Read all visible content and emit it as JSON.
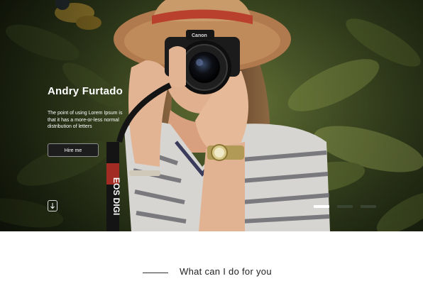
{
  "hero": {
    "name": "Andry Furtado",
    "description": "The point of using Lorem  Ipsum is that it has a more-or-less normal distribution of letters",
    "hire_button": "Hire me",
    "camera_brand": "Canon",
    "strap_text": "EOS DIGI",
    "slides": [
      {
        "state": "active"
      },
      {
        "state": "inactive"
      },
      {
        "state": "inactive"
      }
    ],
    "icons": {
      "scroll": "arrow-down-icon"
    },
    "colors": {
      "button_bg": "#1d1d1d",
      "active_dot": "#ffffff",
      "inactive_dot": "#3c4637"
    }
  },
  "services": {
    "title": "What can I do for you"
  }
}
